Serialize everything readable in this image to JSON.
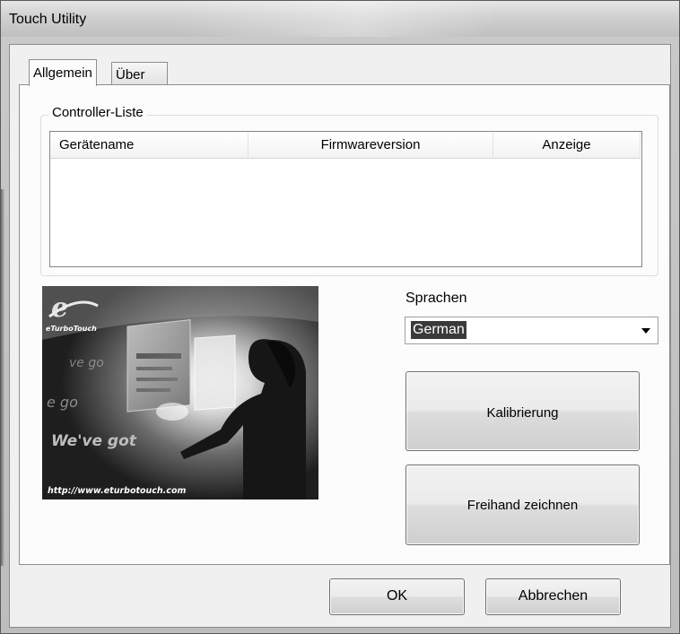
{
  "window": {
    "title": "Touch Utility"
  },
  "tabs": [
    {
      "label": "Allgemein",
      "active": true
    },
    {
      "label": "Über",
      "active": false
    }
  ],
  "controller_list": {
    "group_title": "Controller-Liste",
    "columns": [
      "Gerätename",
      "Firmwareversion",
      "Anzeige"
    ],
    "rows": []
  },
  "promo_image": {
    "logo_text": "eTurboTouch",
    "slogan": "We've got",
    "url": "http://www.eturbotouch.com"
  },
  "language": {
    "label": "Sprachen",
    "selected": "German"
  },
  "actions": {
    "calibrate": "Kalibrierung",
    "freehand": "Freihand zeichnen"
  },
  "footer": {
    "ok": "OK",
    "cancel": "Abbrechen"
  }
}
